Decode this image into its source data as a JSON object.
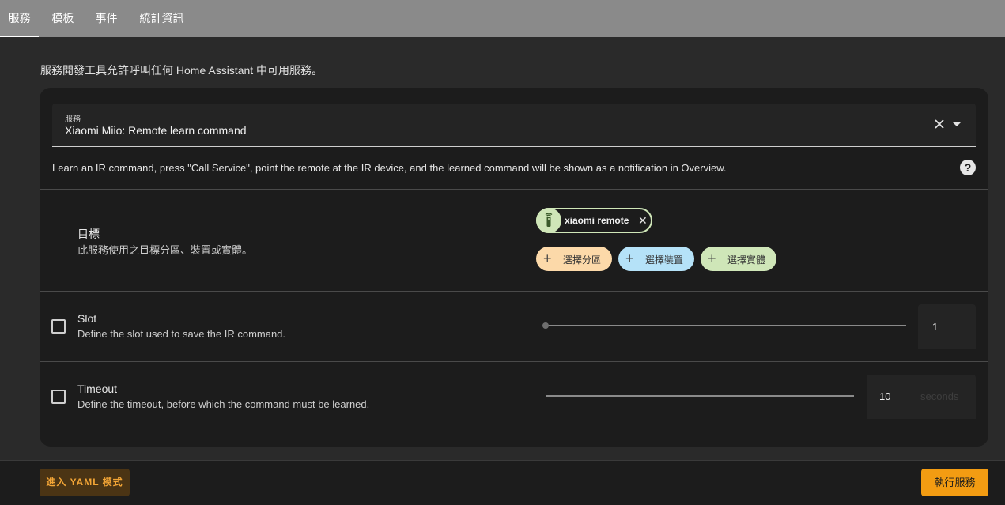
{
  "tabs": [
    {
      "label": "服務",
      "active": true
    },
    {
      "label": "模板",
      "active": false
    },
    {
      "label": "事件",
      "active": false
    },
    {
      "label": "統計資訊",
      "active": false
    }
  ],
  "intro": "服務開發工具允許呼叫任何 Home Assistant 中可用服務。",
  "service_field": {
    "label": "服務",
    "value": "Xiaomi Miio: Remote learn command"
  },
  "description": "Learn an IR command, press \"Call Service\", point the remote at the IR device, and the learned command will be shown as a notification in Overview.",
  "target": {
    "title": "目標",
    "subtitle": "此服務使用之目標分區、裝置或實體。",
    "entity_chip": {
      "label": "xiaomi remote",
      "icon": "remote-icon"
    },
    "add_area": "選擇分區",
    "add_device": "選擇裝置",
    "add_entity": "選擇實體"
  },
  "slot": {
    "title": "Slot",
    "subtitle": "Define the slot used to save the IR command.",
    "value": "1"
  },
  "timeout": {
    "title": "Timeout",
    "subtitle": "Define the timeout, before which the command must be learned.",
    "value": "10",
    "suffix": "seconds"
  },
  "footer": {
    "yaml_button": "進入 YAML 模式",
    "call_button": "執行服務"
  },
  "colors": {
    "accent": "#f39c12",
    "area_chip": "#fcd9a9",
    "device_chip": "#b5e2f8",
    "entity_chip": "#cfe6b8"
  }
}
